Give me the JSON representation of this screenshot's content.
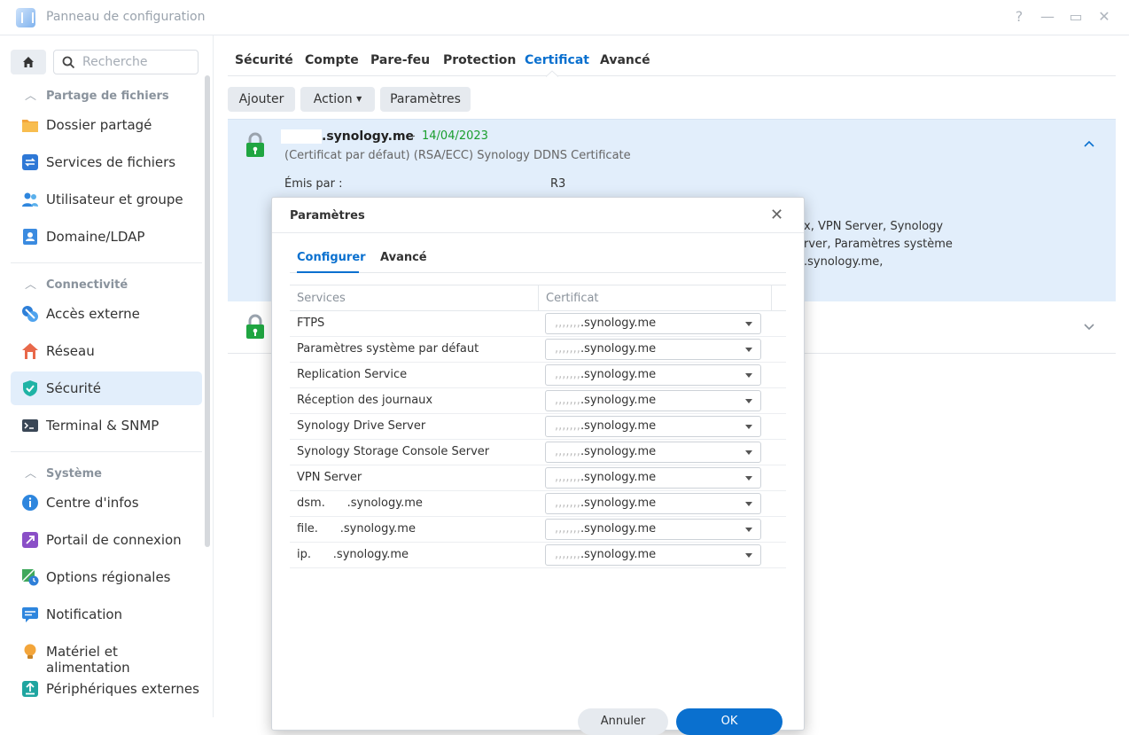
{
  "window": {
    "title": "Panneau de configuration",
    "help": "?",
    "minimize": "—",
    "maximize": "▭",
    "close": "✕"
  },
  "sidebar": {
    "search_placeholder": "Recherche",
    "groups": [
      {
        "label": "Partage de fichiers"
      },
      {
        "label": "Connectivité"
      },
      {
        "label": "Système"
      }
    ],
    "items": [
      {
        "label": "Dossier partagé"
      },
      {
        "label": "Services de fichiers"
      },
      {
        "label": "Utilisateur et groupe"
      },
      {
        "label": "Domaine/LDAP"
      },
      {
        "label": "Accès externe"
      },
      {
        "label": "Réseau"
      },
      {
        "label": "Sécurité"
      },
      {
        "label": "Terminal & SNMP"
      },
      {
        "label": "Centre d'infos"
      },
      {
        "label": "Portail de connexion"
      },
      {
        "label": "Options régionales"
      },
      {
        "label": "Notification"
      },
      {
        "label": "Matériel et alimentation"
      },
      {
        "label": "Périphériques externes"
      }
    ]
  },
  "tabs": [
    "Sécurité",
    "Compte",
    "Pare-feu",
    "Protection",
    "Certificat",
    "Avancé"
  ],
  "toolbar": {
    "add": "Ajouter",
    "action": "Action",
    "params": "Paramètres"
  },
  "certificate": {
    "domain": ".synology.me",
    "separator": "-",
    "date": "14/04/2023",
    "description": "(Certificat par défaut) (RSA/ECC) Synology DDNS Certificate",
    "issued_by_label": "Émis par :",
    "issued_by_value": "R3",
    "line1": "x, VPN Server, Synology",
    "line2": "rver, Paramètres système",
    "line3": ".synology.me,"
  },
  "dialog": {
    "title": "Paramètres",
    "tabs": [
      "Configurer",
      "Avancé"
    ],
    "columns": {
      "service": "Services",
      "certificate": "Certificat"
    },
    "rows": [
      {
        "service": "FTPS",
        "cert": ".synology.me"
      },
      {
        "service": "Paramètres système par défaut",
        "cert": ".synology.me"
      },
      {
        "service": "Replication Service",
        "cert": ".synology.me"
      },
      {
        "service": "Réception des journaux",
        "cert": ".synology.me"
      },
      {
        "service": "Synology Drive Server",
        "cert": ".synology.me"
      },
      {
        "service": "Synology Storage Console Server",
        "cert": ".synology.me"
      },
      {
        "service": "VPN Server",
        "cert": ".synology.me"
      },
      {
        "service": "dsm.      .synology.me",
        "cert": ".synology.me"
      },
      {
        "service": "file.      .synology.me",
        "cert": ".synology.me"
      },
      {
        "service": "ip.      .synology.me",
        "cert": ".synology.me"
      }
    ],
    "cancel": "Annuler",
    "ok": "OK"
  },
  "colors": {
    "accent": "#0a70cf",
    "date": "#1a9e2e",
    "lock": "#1fa541",
    "panel": "#e2eefb"
  }
}
